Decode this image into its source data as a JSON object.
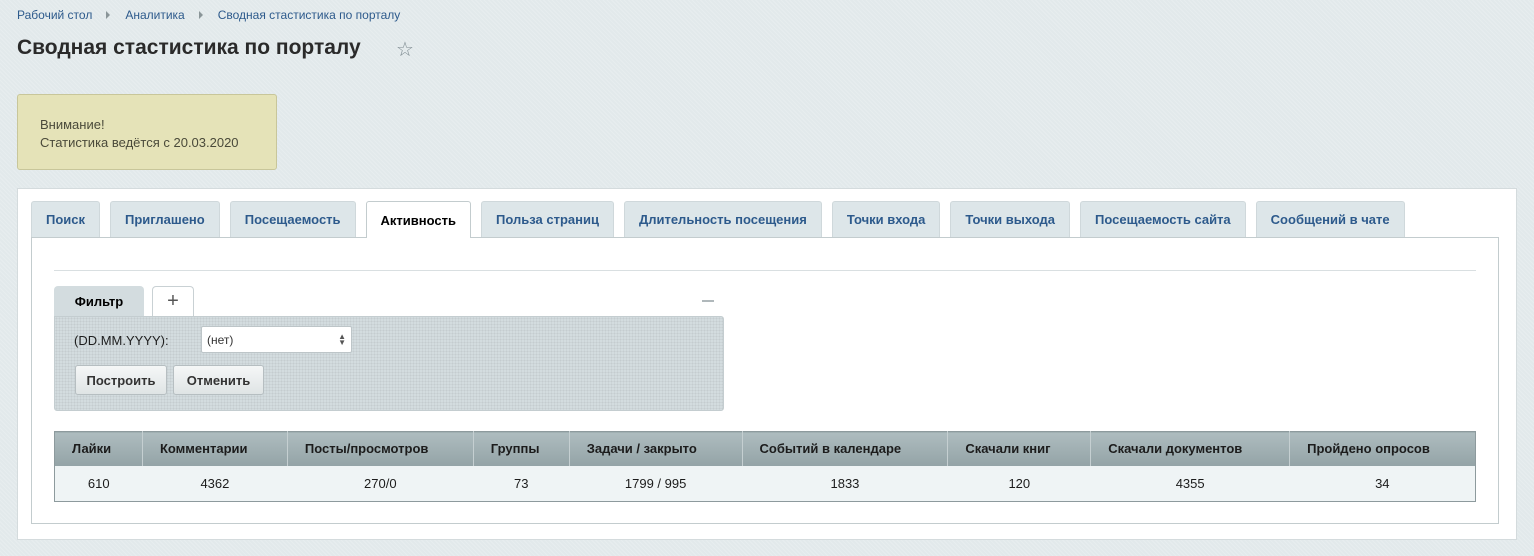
{
  "breadcrumb": [
    "Рабочий стол",
    "Аналитика",
    "Сводная стастистика по порталу"
  ],
  "page_title": "Сводная стастистика по порталу",
  "notice": {
    "line1": "Внимание!",
    "line2": "Статистика ведётся с 20.03.2020"
  },
  "tabs": [
    {
      "label": "Поиск",
      "active": false
    },
    {
      "label": "Приглашено",
      "active": false
    },
    {
      "label": "Посещаемость",
      "active": false
    },
    {
      "label": "Активность",
      "active": true
    },
    {
      "label": "Польза страниц",
      "active": false
    },
    {
      "label": "Длительность посещения",
      "active": false
    },
    {
      "label": "Точки входа",
      "active": false
    },
    {
      "label": "Точки выхода",
      "active": false
    },
    {
      "label": "Посещаемость сайта",
      "active": false
    },
    {
      "label": "Сообщений в чате",
      "active": false
    }
  ],
  "filter": {
    "tab_label": "Фильтр",
    "add_label": "+",
    "date_label": "(DD.MM.YYYY):",
    "date_value": "(нет)",
    "build_label": "Построить",
    "cancel_label": "Отменить"
  },
  "table": {
    "headers": [
      "Лайки",
      "Комментарии",
      "Посты/просмотров",
      "Группы",
      "Задачи / закрыто",
      "Событий в календаре",
      "Скачали книг",
      "Скачали документов",
      "Пройдено опросов"
    ],
    "rows": [
      [
        "610",
        "4362",
        "270/0",
        "73",
        "1799 / 995",
        "1833",
        "120",
        "4355",
        "34"
      ]
    ]
  },
  "colors": {
    "link": "#2d5a8c",
    "notice_bg": "#e5e3b8",
    "table_header": "#a3b2b5"
  }
}
